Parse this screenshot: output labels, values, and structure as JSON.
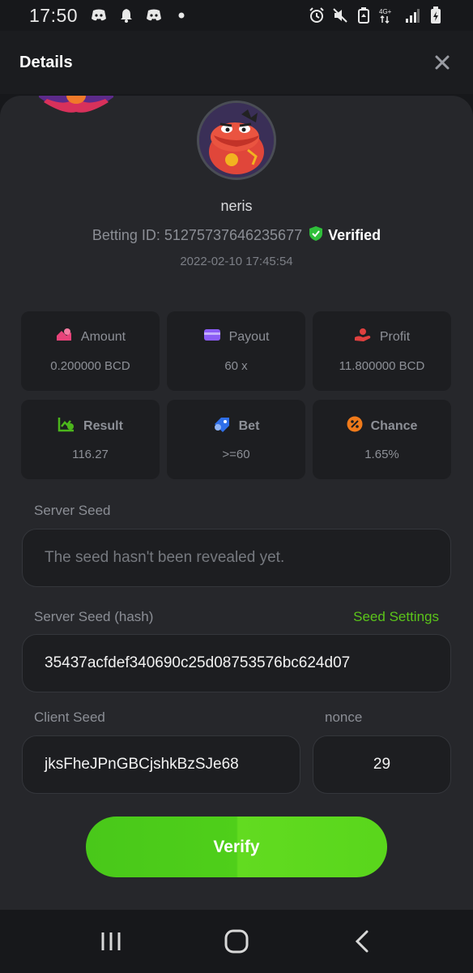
{
  "status_bar": {
    "time": "17:50",
    "left_icons": [
      "discord-icon",
      "bell-icon",
      "discord-icon",
      "dot-icon"
    ],
    "right_icons": [
      "alarm-icon",
      "mute-icon",
      "battery-saver-icon",
      "network-4g-icon",
      "signal-icon",
      "battery-icon"
    ],
    "network_label": "4G+"
  },
  "header": {
    "title": "Details",
    "close_icon": "close-icon"
  },
  "player": {
    "username": "neris",
    "betting_id_label": "Betting ID: 51275737646235677",
    "verified_label": "Verified",
    "timestamp": "2022-02-10 17:45:54"
  },
  "stats": [
    {
      "label": "Amount",
      "value": "0.200000 BCD",
      "icon": "coins-icon",
      "icon_color": "#e8437a"
    },
    {
      "label": "Payout",
      "value": "60 x",
      "icon": "card-icon",
      "icon_color": "#8b5cf6"
    },
    {
      "label": "Profit",
      "value": "11.800000 BCD",
      "icon": "profit-hand-icon",
      "icon_color": "#e0403f"
    },
    {
      "label": "Result",
      "value": "116.27",
      "icon": "chart-check-icon",
      "icon_color": "#4cb61c"
    },
    {
      "label": "Bet",
      "value": ">=60",
      "icon": "tag-icon",
      "icon_color": "#2f6fe8"
    },
    {
      "label": "Chance",
      "value": "1.65%",
      "icon": "percent-icon",
      "icon_color": "#f07a1a"
    }
  ],
  "server_seed": {
    "label": "Server Seed",
    "value": "The seed hasn't been revealed yet."
  },
  "server_seed_hash": {
    "label": "Server Seed (hash)",
    "link": "Seed Settings",
    "value": "35437acfdef340690c25d08753576bc624d07"
  },
  "client_seed": {
    "label": "Client Seed",
    "value": "jksFheJPnGBCjshkBzSJe68"
  },
  "nonce": {
    "label": "nonce",
    "value": "29"
  },
  "verify_button": "Verify",
  "colors": {
    "accent_green": "#5bc41a",
    "verified_shield": "#2fbf3a",
    "background": "#17181b",
    "panel": "#26272b"
  },
  "navbar": [
    "recents-icon",
    "home-icon",
    "back-icon"
  ]
}
